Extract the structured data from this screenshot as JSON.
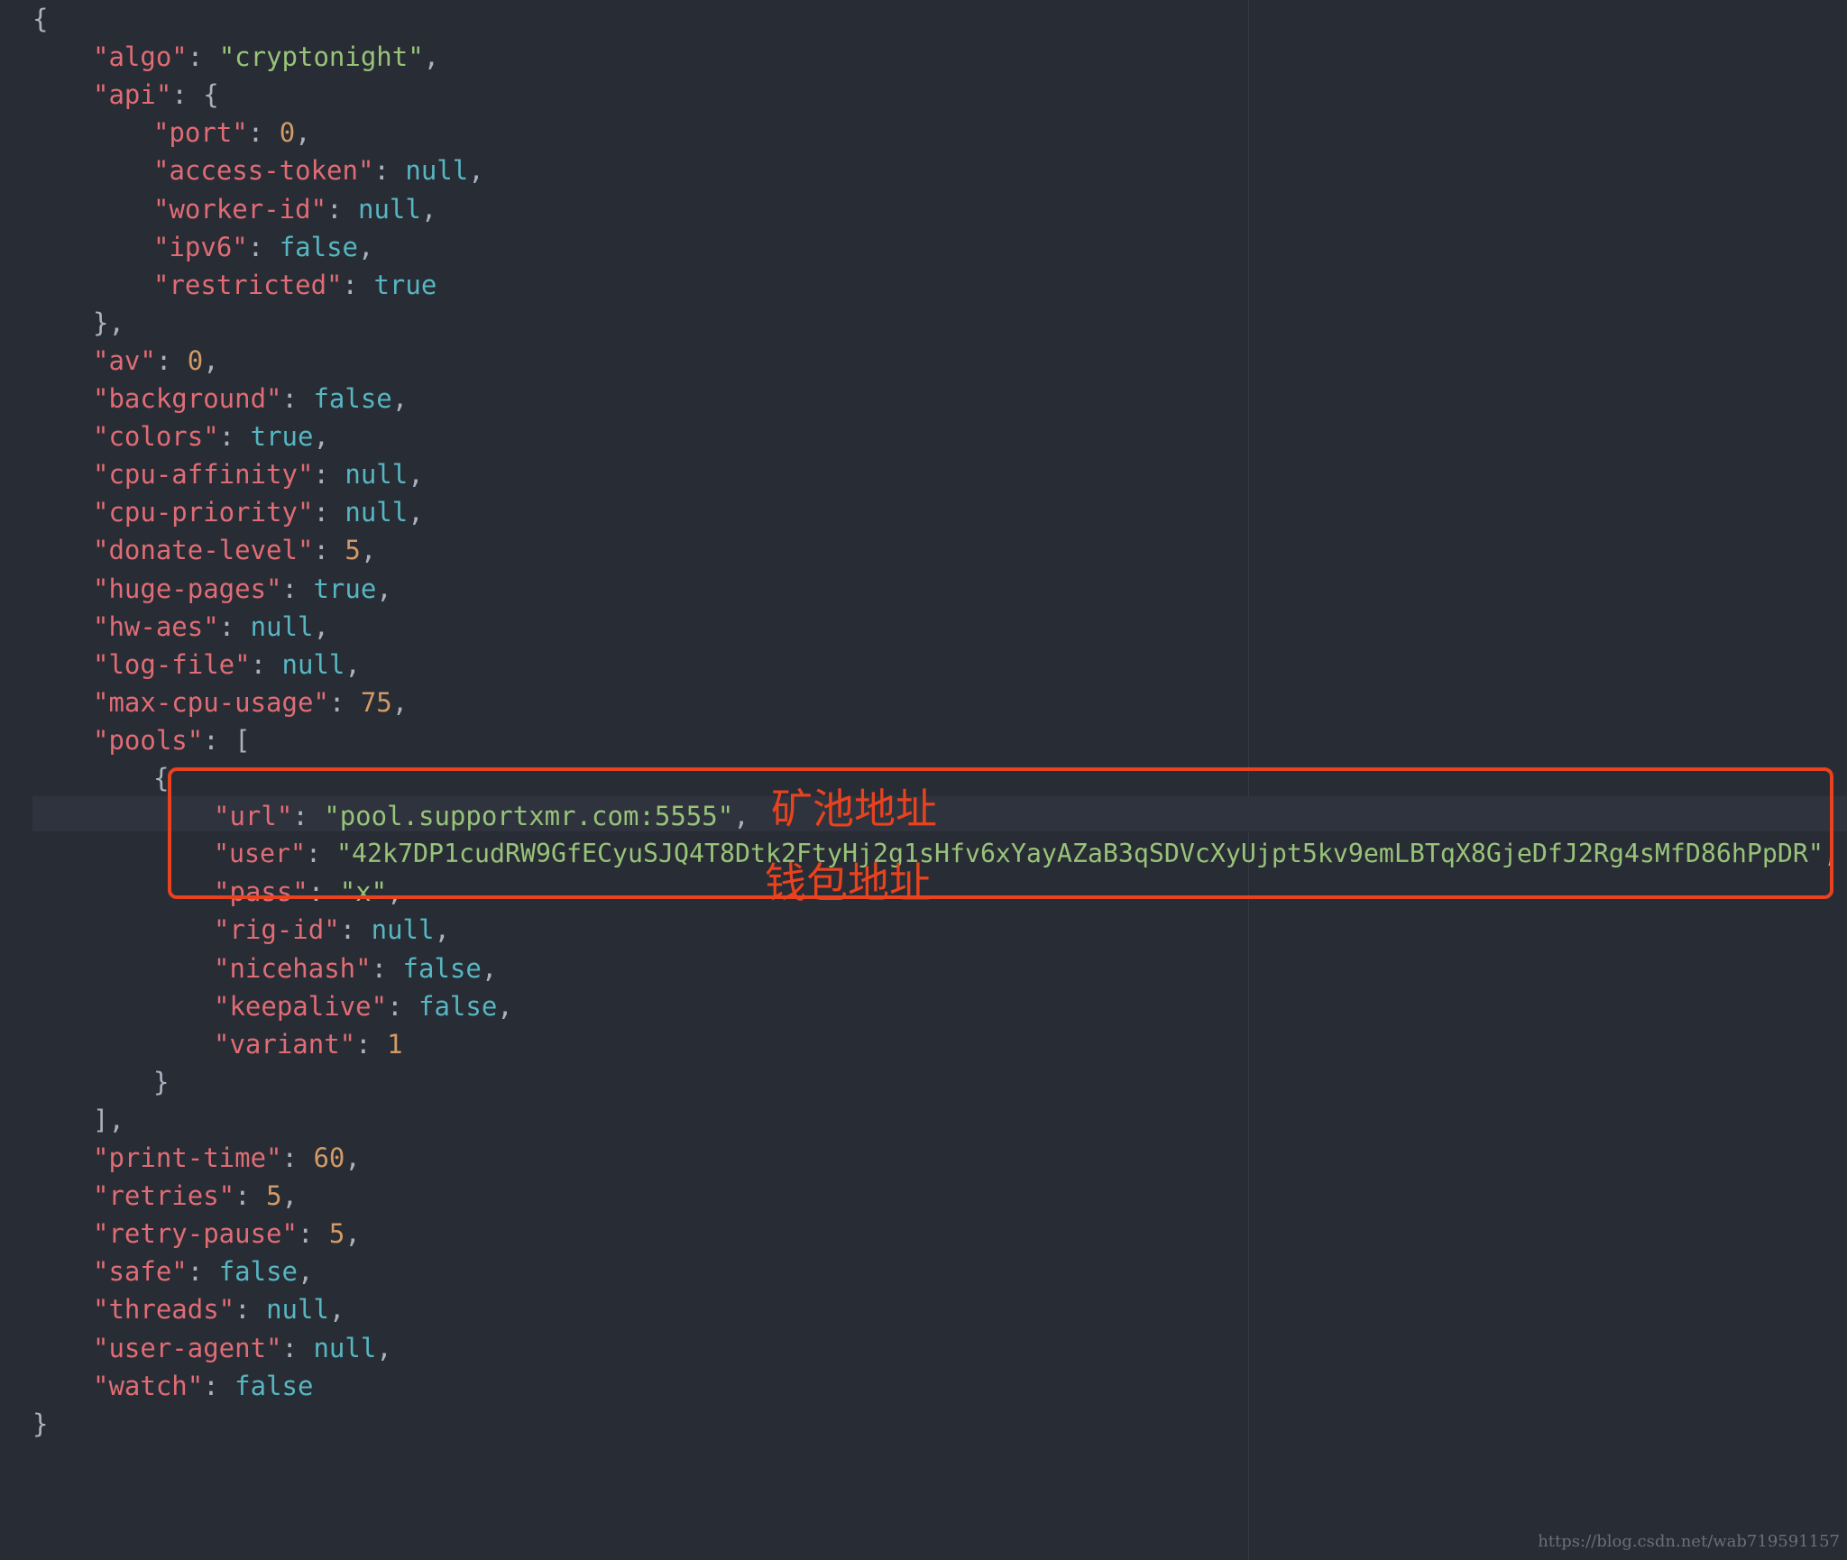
{
  "lines": [
    {
      "indent": 0,
      "tokens": [
        {
          "t": "{",
          "c": "p"
        }
      ]
    },
    {
      "indent": 1,
      "tokens": [
        {
          "t": "\"algo\"",
          "c": "key"
        },
        {
          "t": ": ",
          "c": "p"
        },
        {
          "t": "\"cryptonight\"",
          "c": "str"
        },
        {
          "t": ",",
          "c": "p"
        }
      ]
    },
    {
      "indent": 1,
      "tokens": [
        {
          "t": "\"api\"",
          "c": "key"
        },
        {
          "t": ": {",
          "c": "p"
        }
      ]
    },
    {
      "indent": 2,
      "tokens": [
        {
          "t": "\"port\"",
          "c": "key"
        },
        {
          "t": ": ",
          "c": "p"
        },
        {
          "t": "0",
          "c": "num"
        },
        {
          "t": ",",
          "c": "p"
        }
      ]
    },
    {
      "indent": 2,
      "tokens": [
        {
          "t": "\"access-token\"",
          "c": "key"
        },
        {
          "t": ": ",
          "c": "p"
        },
        {
          "t": "null",
          "c": "kw"
        },
        {
          "t": ",",
          "c": "p"
        }
      ]
    },
    {
      "indent": 2,
      "tokens": [
        {
          "t": "\"worker-id\"",
          "c": "key"
        },
        {
          "t": ": ",
          "c": "p"
        },
        {
          "t": "null",
          "c": "kw"
        },
        {
          "t": ",",
          "c": "p"
        }
      ]
    },
    {
      "indent": 2,
      "tokens": [
        {
          "t": "\"ipv6\"",
          "c": "key"
        },
        {
          "t": ": ",
          "c": "p"
        },
        {
          "t": "false",
          "c": "kw"
        },
        {
          "t": ",",
          "c": "p"
        }
      ]
    },
    {
      "indent": 2,
      "tokens": [
        {
          "t": "\"restricted\"",
          "c": "key"
        },
        {
          "t": ": ",
          "c": "p"
        },
        {
          "t": "true",
          "c": "kw"
        }
      ]
    },
    {
      "indent": 1,
      "tokens": [
        {
          "t": "},",
          "c": "p"
        }
      ]
    },
    {
      "indent": 1,
      "tokens": [
        {
          "t": "\"av\"",
          "c": "key"
        },
        {
          "t": ": ",
          "c": "p"
        },
        {
          "t": "0",
          "c": "num"
        },
        {
          "t": ",",
          "c": "p"
        }
      ]
    },
    {
      "indent": 1,
      "tokens": [
        {
          "t": "\"background\"",
          "c": "key"
        },
        {
          "t": ": ",
          "c": "p"
        },
        {
          "t": "false",
          "c": "kw"
        },
        {
          "t": ",",
          "c": "p"
        }
      ]
    },
    {
      "indent": 1,
      "tokens": [
        {
          "t": "\"colors\"",
          "c": "key"
        },
        {
          "t": ": ",
          "c": "p"
        },
        {
          "t": "true",
          "c": "kw"
        },
        {
          "t": ",",
          "c": "p"
        }
      ]
    },
    {
      "indent": 1,
      "tokens": [
        {
          "t": "\"cpu-affinity\"",
          "c": "key"
        },
        {
          "t": ": ",
          "c": "p"
        },
        {
          "t": "null",
          "c": "kw"
        },
        {
          "t": ",",
          "c": "p"
        }
      ]
    },
    {
      "indent": 1,
      "tokens": [
        {
          "t": "\"cpu-priority\"",
          "c": "key"
        },
        {
          "t": ": ",
          "c": "p"
        },
        {
          "t": "null",
          "c": "kw"
        },
        {
          "t": ",",
          "c": "p"
        }
      ]
    },
    {
      "indent": 1,
      "tokens": [
        {
          "t": "\"donate-level\"",
          "c": "key"
        },
        {
          "t": ": ",
          "c": "p"
        },
        {
          "t": "5",
          "c": "num"
        },
        {
          "t": ",",
          "c": "p"
        }
      ]
    },
    {
      "indent": 1,
      "tokens": [
        {
          "t": "\"huge-pages\"",
          "c": "key"
        },
        {
          "t": ": ",
          "c": "p"
        },
        {
          "t": "true",
          "c": "kw"
        },
        {
          "t": ",",
          "c": "p"
        }
      ]
    },
    {
      "indent": 1,
      "tokens": [
        {
          "t": "\"hw-aes\"",
          "c": "key"
        },
        {
          "t": ": ",
          "c": "p"
        },
        {
          "t": "null",
          "c": "kw"
        },
        {
          "t": ",",
          "c": "p"
        }
      ]
    },
    {
      "indent": 1,
      "tokens": [
        {
          "t": "\"log-file\"",
          "c": "key"
        },
        {
          "t": ": ",
          "c": "p"
        },
        {
          "t": "null",
          "c": "kw"
        },
        {
          "t": ",",
          "c": "p"
        }
      ]
    },
    {
      "indent": 1,
      "tokens": [
        {
          "t": "\"max-cpu-usage\"",
          "c": "key"
        },
        {
          "t": ": ",
          "c": "p"
        },
        {
          "t": "75",
          "c": "num"
        },
        {
          "t": ",",
          "c": "p"
        }
      ]
    },
    {
      "indent": 1,
      "tokens": [
        {
          "t": "\"pools\"",
          "c": "key"
        },
        {
          "t": ": [",
          "c": "p"
        }
      ]
    },
    {
      "indent": 2,
      "tokens": [
        {
          "t": "{",
          "c": "p"
        }
      ]
    },
    {
      "indent": 3,
      "tokens": [
        {
          "t": "\"url\"",
          "c": "key"
        },
        {
          "t": ": ",
          "c": "p"
        },
        {
          "t": "\"pool.supportxmr.com:5555\"",
          "c": "str"
        },
        {
          "t": ",",
          "c": "p"
        }
      ]
    },
    {
      "indent": 3,
      "tokens": [
        {
          "t": "\"user\"",
          "c": "key"
        },
        {
          "t": ": ",
          "c": "p"
        },
        {
          "t": "\"42k7DP1cudRW9GfECyuSJQ4T8Dtk2FtyHj2g1sHfv6xYayAZaB3qSDVcXyUjpt5kv9emLBTqX8GjeDfJ2Rg4sMfD86hPpDR\"",
          "c": "str"
        },
        {
          "t": ",",
          "c": "p"
        }
      ]
    },
    {
      "indent": 3,
      "tokens": [
        {
          "t": "\"pass\"",
          "c": "key"
        },
        {
          "t": ": ",
          "c": "p"
        },
        {
          "t": "\"x\"",
          "c": "str"
        },
        {
          "t": ",",
          "c": "p"
        }
      ]
    },
    {
      "indent": 3,
      "tokens": [
        {
          "t": "\"rig-id\"",
          "c": "key"
        },
        {
          "t": ": ",
          "c": "p"
        },
        {
          "t": "null",
          "c": "kw"
        },
        {
          "t": ",",
          "c": "p"
        }
      ]
    },
    {
      "indent": 3,
      "tokens": [
        {
          "t": "\"nicehash\"",
          "c": "key"
        },
        {
          "t": ": ",
          "c": "p"
        },
        {
          "t": "false",
          "c": "kw"
        },
        {
          "t": ",",
          "c": "p"
        }
      ]
    },
    {
      "indent": 3,
      "tokens": [
        {
          "t": "\"keepalive\"",
          "c": "key"
        },
        {
          "t": ": ",
          "c": "p"
        },
        {
          "t": "false",
          "c": "kw"
        },
        {
          "t": ",",
          "c": "p"
        }
      ]
    },
    {
      "indent": 3,
      "tokens": [
        {
          "t": "\"variant\"",
          "c": "key"
        },
        {
          "t": ": ",
          "c": "p"
        },
        {
          "t": "1",
          "c": "num"
        }
      ]
    },
    {
      "indent": 2,
      "tokens": [
        {
          "t": "}",
          "c": "p"
        }
      ]
    },
    {
      "indent": 1,
      "tokens": [
        {
          "t": "],",
          "c": "p"
        }
      ]
    },
    {
      "indent": 1,
      "tokens": [
        {
          "t": "\"print-time\"",
          "c": "key"
        },
        {
          "t": ": ",
          "c": "p"
        },
        {
          "t": "60",
          "c": "num"
        },
        {
          "t": ",",
          "c": "p"
        }
      ]
    },
    {
      "indent": 1,
      "tokens": [
        {
          "t": "\"retries\"",
          "c": "key"
        },
        {
          "t": ": ",
          "c": "p"
        },
        {
          "t": "5",
          "c": "num"
        },
        {
          "t": ",",
          "c": "p"
        }
      ]
    },
    {
      "indent": 1,
      "tokens": [
        {
          "t": "\"retry-pause\"",
          "c": "key"
        },
        {
          "t": ": ",
          "c": "p"
        },
        {
          "t": "5",
          "c": "num"
        },
        {
          "t": ",",
          "c": "p"
        }
      ]
    },
    {
      "indent": 1,
      "tokens": [
        {
          "t": "\"safe\"",
          "c": "key"
        },
        {
          "t": ": ",
          "c": "p"
        },
        {
          "t": "false",
          "c": "kw"
        },
        {
          "t": ",",
          "c": "p"
        }
      ]
    },
    {
      "indent": 1,
      "tokens": [
        {
          "t": "\"threads\"",
          "c": "key"
        },
        {
          "t": ": ",
          "c": "p"
        },
        {
          "t": "null",
          "c": "kw"
        },
        {
          "t": ",",
          "c": "p"
        }
      ]
    },
    {
      "indent": 1,
      "tokens": [
        {
          "t": "\"user-agent\"",
          "c": "key"
        },
        {
          "t": ": ",
          "c": "p"
        },
        {
          "t": "null",
          "c": "kw"
        },
        {
          "t": ",",
          "c": "p"
        }
      ]
    },
    {
      "indent": 1,
      "tokens": [
        {
          "t": "\"watch\"",
          "c": "key"
        },
        {
          "t": ": ",
          "c": "p"
        },
        {
          "t": "false",
          "c": "kw"
        }
      ]
    },
    {
      "indent": 0,
      "tokens": [
        {
          "t": "}",
          "c": "p"
        }
      ]
    }
  ],
  "annotations": {
    "pool_address": "矿池地址",
    "wallet_address": "钱包地址"
  },
  "watermark": "https://blog.csdn.net/wab719591157",
  "colors": {
    "background": "#282c34",
    "key": "#e06c75",
    "string": "#98c379",
    "number": "#d19a66",
    "keyword": "#56b6c2",
    "punctuation": "#abb2bf",
    "annotation": "#e8421f"
  }
}
